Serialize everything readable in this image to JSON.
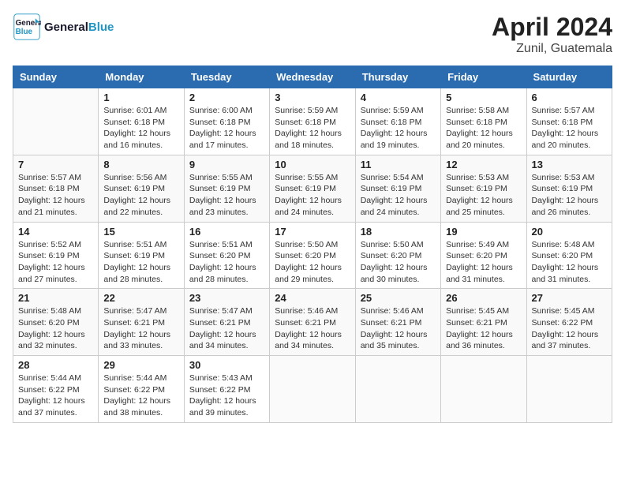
{
  "header": {
    "logo_line1": "General",
    "logo_line2": "Blue",
    "month": "April 2024",
    "location": "Zunil, Guatemala"
  },
  "days_of_week": [
    "Sunday",
    "Monday",
    "Tuesday",
    "Wednesday",
    "Thursday",
    "Friday",
    "Saturday"
  ],
  "weeks": [
    [
      {
        "day": "",
        "info": ""
      },
      {
        "day": "1",
        "info": "Sunrise: 6:01 AM\nSunset: 6:18 PM\nDaylight: 12 hours\nand 16 minutes."
      },
      {
        "day": "2",
        "info": "Sunrise: 6:00 AM\nSunset: 6:18 PM\nDaylight: 12 hours\nand 17 minutes."
      },
      {
        "day": "3",
        "info": "Sunrise: 5:59 AM\nSunset: 6:18 PM\nDaylight: 12 hours\nand 18 minutes."
      },
      {
        "day": "4",
        "info": "Sunrise: 5:59 AM\nSunset: 6:18 PM\nDaylight: 12 hours\nand 19 minutes."
      },
      {
        "day": "5",
        "info": "Sunrise: 5:58 AM\nSunset: 6:18 PM\nDaylight: 12 hours\nand 20 minutes."
      },
      {
        "day": "6",
        "info": "Sunrise: 5:57 AM\nSunset: 6:18 PM\nDaylight: 12 hours\nand 20 minutes."
      }
    ],
    [
      {
        "day": "7",
        "info": "Sunrise: 5:57 AM\nSunset: 6:18 PM\nDaylight: 12 hours\nand 21 minutes."
      },
      {
        "day": "8",
        "info": "Sunrise: 5:56 AM\nSunset: 6:19 PM\nDaylight: 12 hours\nand 22 minutes."
      },
      {
        "day": "9",
        "info": "Sunrise: 5:55 AM\nSunset: 6:19 PM\nDaylight: 12 hours\nand 23 minutes."
      },
      {
        "day": "10",
        "info": "Sunrise: 5:55 AM\nSunset: 6:19 PM\nDaylight: 12 hours\nand 24 minutes."
      },
      {
        "day": "11",
        "info": "Sunrise: 5:54 AM\nSunset: 6:19 PM\nDaylight: 12 hours\nand 24 minutes."
      },
      {
        "day": "12",
        "info": "Sunrise: 5:53 AM\nSunset: 6:19 PM\nDaylight: 12 hours\nand 25 minutes."
      },
      {
        "day": "13",
        "info": "Sunrise: 5:53 AM\nSunset: 6:19 PM\nDaylight: 12 hours\nand 26 minutes."
      }
    ],
    [
      {
        "day": "14",
        "info": "Sunrise: 5:52 AM\nSunset: 6:19 PM\nDaylight: 12 hours\nand 27 minutes."
      },
      {
        "day": "15",
        "info": "Sunrise: 5:51 AM\nSunset: 6:19 PM\nDaylight: 12 hours\nand 28 minutes."
      },
      {
        "day": "16",
        "info": "Sunrise: 5:51 AM\nSunset: 6:20 PM\nDaylight: 12 hours\nand 28 minutes."
      },
      {
        "day": "17",
        "info": "Sunrise: 5:50 AM\nSunset: 6:20 PM\nDaylight: 12 hours\nand 29 minutes."
      },
      {
        "day": "18",
        "info": "Sunrise: 5:50 AM\nSunset: 6:20 PM\nDaylight: 12 hours\nand 30 minutes."
      },
      {
        "day": "19",
        "info": "Sunrise: 5:49 AM\nSunset: 6:20 PM\nDaylight: 12 hours\nand 31 minutes."
      },
      {
        "day": "20",
        "info": "Sunrise: 5:48 AM\nSunset: 6:20 PM\nDaylight: 12 hours\nand 31 minutes."
      }
    ],
    [
      {
        "day": "21",
        "info": "Sunrise: 5:48 AM\nSunset: 6:20 PM\nDaylight: 12 hours\nand 32 minutes."
      },
      {
        "day": "22",
        "info": "Sunrise: 5:47 AM\nSunset: 6:21 PM\nDaylight: 12 hours\nand 33 minutes."
      },
      {
        "day": "23",
        "info": "Sunrise: 5:47 AM\nSunset: 6:21 PM\nDaylight: 12 hours\nand 34 minutes."
      },
      {
        "day": "24",
        "info": "Sunrise: 5:46 AM\nSunset: 6:21 PM\nDaylight: 12 hours\nand 34 minutes."
      },
      {
        "day": "25",
        "info": "Sunrise: 5:46 AM\nSunset: 6:21 PM\nDaylight: 12 hours\nand 35 minutes."
      },
      {
        "day": "26",
        "info": "Sunrise: 5:45 AM\nSunset: 6:21 PM\nDaylight: 12 hours\nand 36 minutes."
      },
      {
        "day": "27",
        "info": "Sunrise: 5:45 AM\nSunset: 6:22 PM\nDaylight: 12 hours\nand 37 minutes."
      }
    ],
    [
      {
        "day": "28",
        "info": "Sunrise: 5:44 AM\nSunset: 6:22 PM\nDaylight: 12 hours\nand 37 minutes."
      },
      {
        "day": "29",
        "info": "Sunrise: 5:44 AM\nSunset: 6:22 PM\nDaylight: 12 hours\nand 38 minutes."
      },
      {
        "day": "30",
        "info": "Sunrise: 5:43 AM\nSunset: 6:22 PM\nDaylight: 12 hours\nand 39 minutes."
      },
      {
        "day": "",
        "info": ""
      },
      {
        "day": "",
        "info": ""
      },
      {
        "day": "",
        "info": ""
      },
      {
        "day": "",
        "info": ""
      }
    ]
  ]
}
